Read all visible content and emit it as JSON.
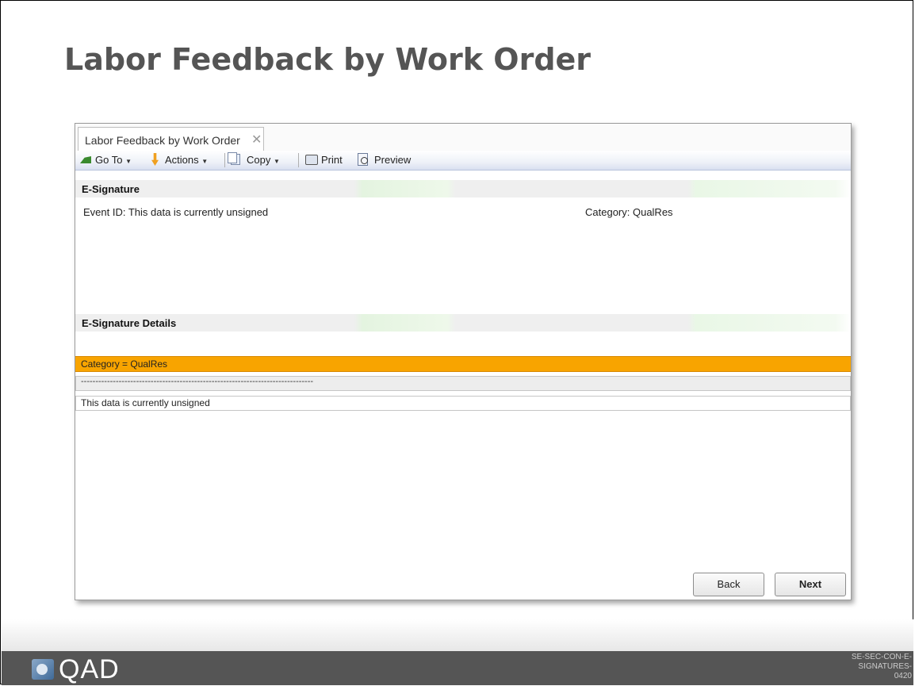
{
  "slide": {
    "title": "Labor Feedback by Work Order",
    "doc_code_lines": [
      "SE-SEC-CON-E-",
      "SIGNATURES-",
      "0420"
    ]
  },
  "window": {
    "tab_label": "Labor Feedback by Work Order",
    "toolbar": {
      "goto_label": "Go To",
      "actions_label": "Actions",
      "copy_label": "Copy",
      "print_label": "Print",
      "preview_label": "Preview"
    },
    "esignature": {
      "header": "E-Signature",
      "event_id": "Event ID: This data is currently unsigned",
      "category": "Category: QualRes"
    },
    "details": {
      "header": "E-Signature Details",
      "category_row": "Category = QualRes",
      "separator_row": "--------------------------------------------------------------------------------",
      "unsigned_row": "This data is currently unsigned"
    },
    "buttons": {
      "back": "Back",
      "next": "Next"
    }
  },
  "footer": {
    "logo_text": "QAD"
  }
}
